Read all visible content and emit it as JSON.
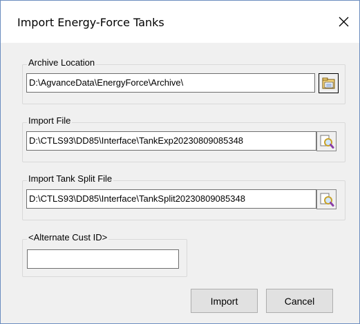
{
  "dialog": {
    "title": "Import Energy-Force Tanks",
    "close_icon": "close-icon"
  },
  "archive": {
    "label": "Archive Location",
    "value": "D:\\AgvanceData\\EnergyForce\\Archive\\",
    "browse_icon": "folder-open-icon"
  },
  "import_file": {
    "label": "Import File",
    "value": "D:\\CTLS93\\DD85\\Interface\\TankExp20230809085348",
    "browse_icon": "file-search-icon"
  },
  "split_file": {
    "label": "Import Tank Split File",
    "value": "D:\\CTLS93\\DD85\\Interface\\TankSplit20230809085348",
    "browse_icon": "file-search-icon"
  },
  "alt_cust": {
    "label": "<Alternate Cust ID>",
    "value": ""
  },
  "buttons": {
    "import_label": "Import",
    "cancel_label": "Cancel"
  }
}
